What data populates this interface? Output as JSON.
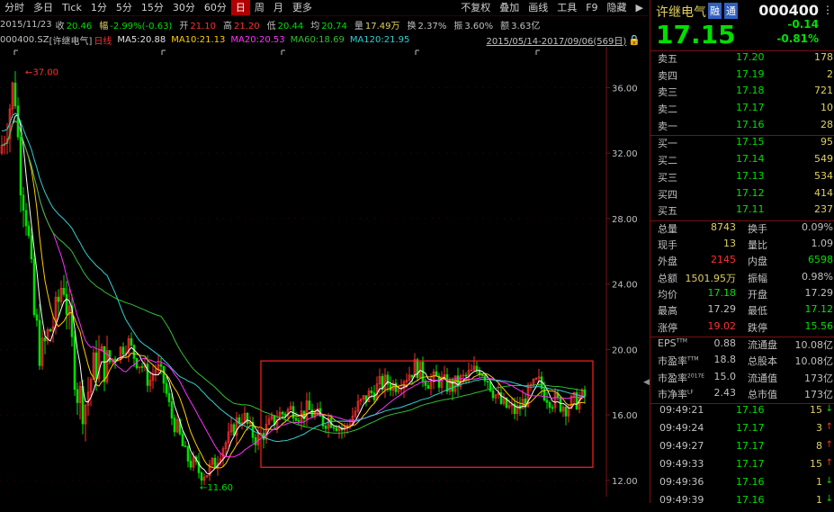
{
  "toolbar": {
    "items": [
      "分时",
      "多日",
      "Tick",
      "1分",
      "5分",
      "15分",
      "30分",
      "60分",
      "日",
      "周",
      "月",
      "更多"
    ],
    "active_index": 8,
    "right_items": [
      "不复权",
      "叠加",
      "画线",
      "工具",
      "F9",
      "隐藏"
    ],
    "right_icon": "arrow-right-icon"
  },
  "info": {
    "date": "2015/11/23",
    "close_label": "收",
    "close": "20.46",
    "change_label": "幅",
    "change": "-2.99%(-0.63)",
    "open_label": "开",
    "open": "21.10",
    "high_label": "高",
    "high": "21.20",
    "low_label": "低",
    "low": "20.44",
    "avg_label": "均",
    "avg": "20.74",
    "volume_label": "量",
    "volume": "17.49万",
    "turnover_label": "换",
    "turnover": "2.37%",
    "amplitude_label": "振",
    "amplitude": "3.60%",
    "amount_label": "额",
    "amount": "3.63亿"
  },
  "ma_bar": {
    "code": "000400.SZ",
    "name": "[许继电气]",
    "period": "日线",
    "ma5": "MA5:20.88",
    "ma10": "MA10:21.13",
    "ma20": "MA20:20.53",
    "ma60": "MA60:18.69",
    "ma120": "MA120:21.95",
    "range": "2015/05/14-2017/09/06(569日)"
  },
  "chart_data": {
    "type": "candlestick",
    "y_ticks": [
      "36.00",
      "32.00",
      "28.00",
      "24.00",
      "20.00",
      "16.00",
      "12.00"
    ],
    "ylim": [
      11,
      38.5
    ],
    "max_label": "37.00",
    "min_label": "11.60",
    "max_value": 37.0,
    "min_value": 11.6,
    "close_path": [
      [
        0,
        32
      ],
      [
        8,
        34
      ],
      [
        16,
        36.5
      ],
      [
        22,
        31
      ],
      [
        30,
        28
      ],
      [
        38,
        22
      ],
      [
        46,
        19.5
      ],
      [
        54,
        21
      ],
      [
        62,
        22
      ],
      [
        70,
        24.5
      ],
      [
        78,
        21
      ],
      [
        86,
        17.5
      ],
      [
        94,
        16.5
      ],
      [
        102,
        18.5
      ],
      [
        110,
        19.5
      ],
      [
        118,
        19
      ],
      [
        126,
        19.5
      ],
      [
        134,
        20
      ],
      [
        142,
        20.5
      ],
      [
        150,
        19.5
      ],
      [
        158,
        19
      ],
      [
        166,
        18
      ],
      [
        174,
        19
      ],
      [
        182,
        18
      ],
      [
        190,
        16
      ],
      [
        198,
        15
      ],
      [
        206,
        13.5
      ],
      [
        214,
        13
      ],
      [
        222,
        12.5
      ],
      [
        230,
        12.5
      ],
      [
        238,
        13
      ],
      [
        246,
        14
      ],
      [
        254,
        14.5
      ],
      [
        262,
        15.5
      ],
      [
        270,
        16
      ],
      [
        278,
        15
      ],
      [
        286,
        14.5
      ],
      [
        294,
        15
      ],
      [
        302,
        15.5
      ],
      [
        310,
        16
      ],
      [
        318,
        16.2
      ],
      [
        326,
        16.4
      ],
      [
        334,
        16
      ],
      [
        342,
        16.3
      ],
      [
        350,
        16
      ],
      [
        358,
        15.6
      ],
      [
        366,
        15.8
      ],
      [
        374,
        15.5
      ],
      [
        382,
        15
      ],
      [
        390,
        15.8
      ],
      [
        398,
        16.5
      ],
      [
        406,
        17
      ],
      [
        414,
        17.4
      ],
      [
        422,
        17.8
      ],
      [
        430,
        18
      ],
      [
        438,
        17.8
      ],
      [
        446,
        18.2
      ],
      [
        454,
        18.5
      ],
      [
        462,
        19
      ],
      [
        470,
        18.4
      ],
      [
        478,
        18
      ],
      [
        486,
        18.2
      ],
      [
        494,
        17.9
      ],
      [
        502,
        17.7
      ],
      [
        510,
        18
      ],
      [
        518,
        18.3
      ],
      [
        526,
        18.6
      ],
      [
        534,
        18.9
      ],
      [
        542,
        18.2
      ],
      [
        550,
        17.3
      ],
      [
        558,
        16.6
      ],
      [
        566,
        16.4
      ],
      [
        574,
        16.2
      ],
      [
        582,
        16.8
      ],
      [
        590,
        17.5
      ],
      [
        598,
        18
      ],
      [
        606,
        17.3
      ],
      [
        614,
        16.9
      ],
      [
        622,
        16.7
      ],
      [
        630,
        16.5
      ],
      [
        638,
        16.8
      ],
      [
        646,
        17.0
      ],
      [
        652,
        17.2
      ]
    ],
    "candle_colors": {
      "up": "#ff3030",
      "down": "#00e000"
    },
    "ma_colors": {
      "ma5": "#ffffff",
      "ma10": "#ffcc00",
      "ma20": "#ff30ff",
      "ma60": "#30c030",
      "ma120": "#30d0d0"
    },
    "highlight_box_color": "#ff2020"
  },
  "quote": {
    "name": "许继电气",
    "badge1": "融",
    "badge2": "通",
    "code": "000400",
    "price": "17.15",
    "change": "-0.14",
    "change_pct": "-0.81%",
    "asks": [
      {
        "label": "卖五",
        "price": "17.20",
        "vol": "178"
      },
      {
        "label": "卖四",
        "price": "17.19",
        "vol": "2"
      },
      {
        "label": "卖三",
        "price": "17.18",
        "vol": "721"
      },
      {
        "label": "卖二",
        "price": "17.17",
        "vol": "10"
      },
      {
        "label": "卖一",
        "price": "17.16",
        "vol": "28"
      }
    ],
    "bids": [
      {
        "label": "买一",
        "price": "17.15",
        "vol": "95"
      },
      {
        "label": "买二",
        "price": "17.14",
        "vol": "549"
      },
      {
        "label": "买三",
        "price": "17.13",
        "vol": "534"
      },
      {
        "label": "买四",
        "price": "17.12",
        "vol": "414"
      },
      {
        "label": "买五",
        "price": "17.11",
        "vol": "237"
      }
    ],
    "stats": [
      {
        "l1": "总量",
        "v1": "8743",
        "c1": "#e0d060",
        "l2": "换手",
        "v2": "0.09%",
        "c2": "#c0c0c0"
      },
      {
        "l1": "现手",
        "v1": "13",
        "c1": "#e0d060",
        "l2": "量比",
        "v2": "1.09",
        "c2": "#c0c0c0"
      },
      {
        "l1": "外盘",
        "v1": "2145",
        "c1": "#ff3030",
        "l2": "内盘",
        "v2": "6598",
        "c2": "#00e000"
      },
      {
        "l1": "总额",
        "v1": "1501.95万",
        "c1": "#e0d060",
        "l2": "振幅",
        "v2": "0.98%",
        "c2": "#c0c0c0"
      },
      {
        "l1": "均价",
        "v1": "17.18",
        "c1": "#00e000",
        "l2": "开盘",
        "v2": "17.29",
        "c2": "#c0c0c0"
      },
      {
        "l1": "最高",
        "v1": "17.29",
        "c1": "#c0c0c0",
        "l2": "最低",
        "v2": "17.12",
        "c2": "#00e000"
      },
      {
        "l1": "涨停",
        "v1": "19.02",
        "c1": "#ff3030",
        "l2": "跌停",
        "v2": "15.56",
        "c2": "#00e000"
      }
    ],
    "fundamentals": [
      {
        "l1": "EPS",
        "sup1": "TTM",
        "v1": "0.88",
        "l2": "流通盘",
        "v2": "10.08亿"
      },
      {
        "l1": "市盈率",
        "sup1": "TTM",
        "v1": "18.8",
        "l2": "总股本",
        "v2": "10.08亿"
      },
      {
        "l1": "市盈率",
        "sup1": "2017E",
        "v1": "15.0",
        "l2": "流通值",
        "v2": "173亿"
      },
      {
        "l1": "市净率",
        "sup1": "LF",
        "v1": "2.43",
        "l2": "总市值",
        "v2": "173亿"
      }
    ],
    "trades": [
      {
        "time": "09:49:21",
        "price": "17.16",
        "vol": "15",
        "dir": "↓",
        "dirColor": "#00e000"
      },
      {
        "time": "09:49:24",
        "price": "17.17",
        "vol": "3",
        "dir": "↑",
        "dirColor": "#ff3030"
      },
      {
        "time": "09:49:27",
        "price": "17.17",
        "vol": "8",
        "dir": "↑",
        "dirColor": "#ff3030"
      },
      {
        "time": "09:49:33",
        "price": "17.17",
        "vol": "15",
        "dir": "↑",
        "dirColor": "#ff3030"
      },
      {
        "time": "09:49:36",
        "price": "17.16",
        "vol": "1",
        "dir": "↓",
        "dirColor": "#00e000"
      },
      {
        "time": "09:49:39",
        "price": "17.16",
        "vol": "1",
        "dir": "↓",
        "dirColor": "#00e000"
      }
    ]
  }
}
